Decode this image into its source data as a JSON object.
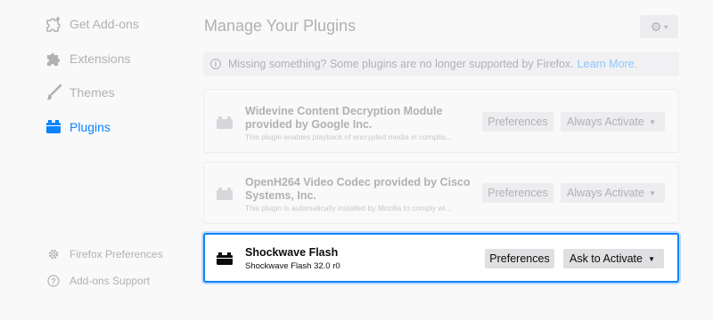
{
  "sidebar": {
    "items": [
      {
        "label": "Get Add-ons",
        "icon": "puzzle-sparkle-icon"
      },
      {
        "label": "Extensions",
        "icon": "puzzle-icon"
      },
      {
        "label": "Themes",
        "icon": "brush-icon"
      },
      {
        "label": "Plugins",
        "icon": "plugin-icon"
      }
    ],
    "footer": [
      {
        "label": "Firefox Preferences",
        "icon": "gear-icon"
      },
      {
        "label": "Add-ons Support",
        "icon": "help-icon"
      }
    ]
  },
  "main": {
    "title": "Manage Your Plugins",
    "notice": {
      "text": "Missing something? Some plugins are no longer supported by Firefox.",
      "link": "Learn More."
    },
    "plugins": [
      {
        "name": "Widevine Content Decryption Module provided by Google Inc.",
        "description": "This plugin enables playback of encrypted media in complia...",
        "preferences": "Preferences",
        "activation": "Always Activate"
      },
      {
        "name": "OpenH264 Video Codec provided by Cisco Systems, Inc.",
        "description": "This plugin is automatically installed by Mozilla to comply wi...",
        "preferences": "Preferences",
        "activation": "Always Activate"
      },
      {
        "name": "Shockwave Flash",
        "description": "Shockwave Flash 32.0 r0",
        "preferences": "Preferences",
        "activation": "Ask to Activate"
      }
    ]
  },
  "colors": {
    "accent": "#0a84ff",
    "muted": "#b1b1b3"
  }
}
